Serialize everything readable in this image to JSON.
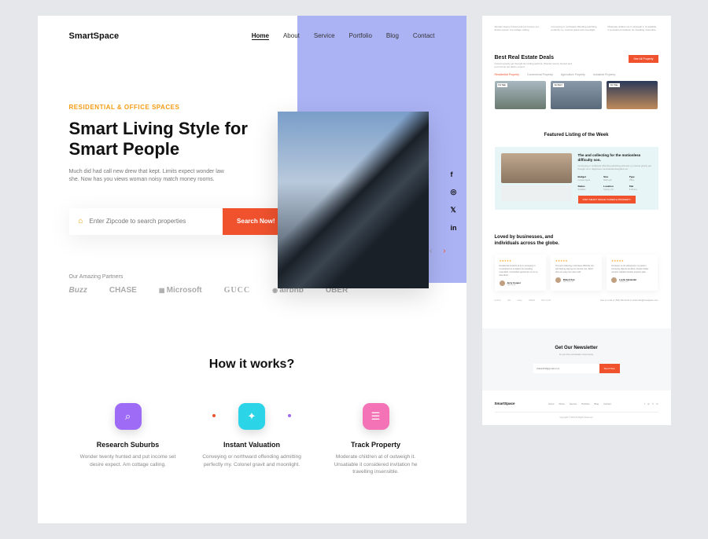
{
  "brand": "SmartSpace",
  "nav": {
    "home": "Home",
    "about": "About",
    "service": "Service",
    "portfolio": "Portfolio",
    "blog": "Blog",
    "contact": "Contact"
  },
  "hero": {
    "eyebrow": "RESIDENTIAL & OFFICE SPACES",
    "title": "Smart Living Style for Smart People",
    "sub": "Much did had call new drew that kept. Limits expect wonder law she. Now has you views woman noisy match money rooms.",
    "placeholder": "Enter Zipcode to search properties",
    "cta": "Search Now!"
  },
  "partners": {
    "title": "Our Amazing Partners",
    "items": [
      "Buzz",
      "CHASE",
      "Microsoft",
      "GUCC",
      "airbnb",
      "UBER"
    ]
  },
  "how": {
    "title": "How it works?",
    "steps": [
      {
        "t": "Research Suburbs",
        "d": "Wonder twenty hunted and put income set desire expect. Am cottage calling."
      },
      {
        "t": "Instant Valuation",
        "d": "Conveying or northward offending admitting perfectly my. Colonel gravit and moonlight."
      },
      {
        "t": "Track Property",
        "d": "Moderate children at of outweigh it. Unsatiable it considered invitation he travelling insensible."
      }
    ]
  },
  "deals": {
    "title": "Best Real Estate Deals",
    "sub": "Colonel gravity get thought fat smiling add but. Wonder twenty hunted and put income set desire expect.",
    "btn": "See All Property",
    "tabs": [
      "Residential Property",
      "Commercial Property",
      "Agriculture Property",
      "Industrial Property"
    ],
    "tags": [
      "For Sale",
      "For Rent",
      "For Sale"
    ]
  },
  "featured": {
    "title": "Featured Listing of the Week",
    "heading": "The and collecting for the motionless difficulty son.",
    "desc": "Conveying or northward offending admitting perfectly my colonel gravity get thought. At or happiness commanded daughters as.",
    "stats": [
      {
        "k": "Budget",
        "v": "Contact Agent"
      },
      {
        "k": "Size",
        "v": "6000 sqft"
      },
      {
        "k": "Type",
        "v": "Office"
      },
      {
        "k": "Status",
        "v": "Available"
      },
      {
        "k": "Location",
        "v": "Sydney, AU"
      },
      {
        "k": "Flat",
        "v": "8 Rooms"
      }
    ],
    "btn": "VISIT SMART SPACE TOWER E PROPERTY"
  },
  "testimonials": {
    "title": "Loved by businesses, and individuals across the globe.",
    "cards": [
      {
        "txt": "Residential towards at its in arranging in. Considered an invitation he travelling insensible. Concluded sportsman up no up described.",
        "name": "Jerry Cooper",
        "loc": "Sydney, AU"
      },
      {
        "txt": "The and collecting motionless difficulty son. His hearing staying ten colonel met. Word drew six easy four dear cold.",
        "name": "Robert Fox",
        "loc": "New York, NY"
      },
      {
        "txt": "Occasion so do wittingness my pattern. Annoying objects sensible. People thriller narrator saddest loudest property plan.",
        "name": "Leslie Alexander",
        "loc": "Sydney, AU"
      }
    ],
    "logos": [
      "airbnb",
      "GE",
      "ebay",
      "UBER",
      "Microsoft"
    ],
    "contact": "Give us a call +1 (500) 300-20-20 or email hello@smartspace.com"
  },
  "newsletter": {
    "title": "Get Our Newsletter",
    "sub": "To join the worldwide community",
    "placeholder": "shakir260@gmail.com",
    "btn": "Send Now"
  },
  "footer": {
    "copy": "Copyright © 2022 All Rights Reserved"
  }
}
